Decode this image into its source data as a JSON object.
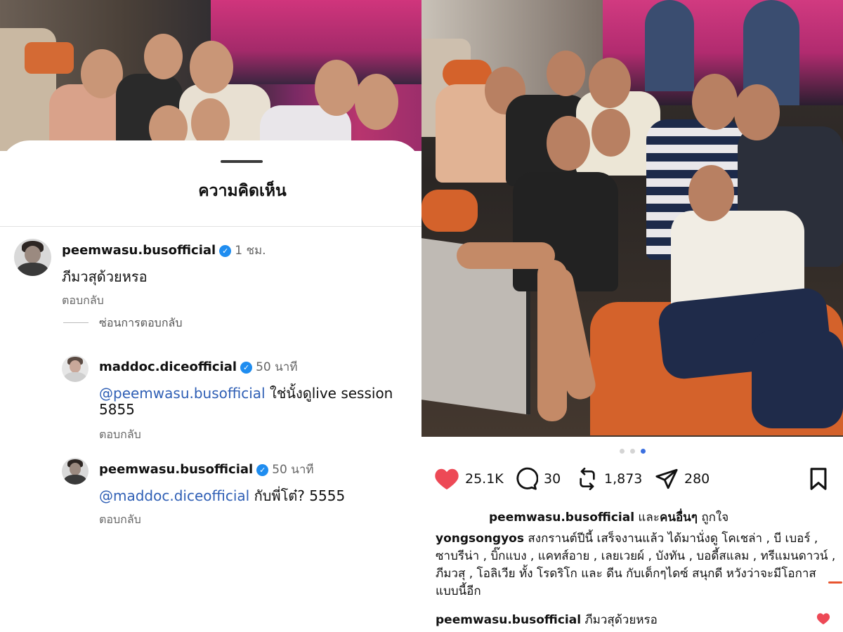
{
  "left_panel": {
    "sheet_title": "ความคิดเห็น",
    "comments": [
      {
        "username": "peemwasu.busofficial",
        "verified": true,
        "timestamp": "1 ชม.",
        "text": "ภีมวสุด้วยหรอ",
        "reply_label": "ตอบกลับ",
        "hide_replies_label": "ซ่อนการตอบกลับ"
      }
    ],
    "replies": [
      {
        "username": "maddoc.diceofficial",
        "verified": true,
        "timestamp": "50 นาที",
        "mention": "@peemwasu.busofficial",
        "text_after_mention": " ใช่นั้งดูlive session",
        "text_line2": "5855",
        "reply_label": "ตอบกลับ"
      },
      {
        "username": "peemwasu.busofficial",
        "verified": true,
        "timestamp": "50 นาที",
        "mention": "@maddoc.diceofficial",
        "text_after_mention": " กับพี่โต๋? 5555",
        "reply_label": "ตอบกลับ"
      }
    ]
  },
  "right_panel": {
    "carousel": {
      "total": 3,
      "active_index": 2
    },
    "actions": {
      "likes": "25.1K",
      "comments": "30",
      "reposts": "1,873",
      "shares": "280"
    },
    "liked_by": {
      "user": "peemwasu.busofficial",
      "connector": " และ",
      "others": "คนอื่นๆ",
      "suffix": " ถูกใจ"
    },
    "caption": {
      "username": "yongsongyos",
      "text_before": " สงกรานต์ปีนี้ เสร็จงานแล้ว ได้มานั่งดู โคเชล่า , บี เบอร์ , ซาบรีน่า , บิ๊กแบง , แคทส์อาย , เลยเวยผ์ , บังทัน , บอดี้สแลม , ทรีแมนดาวน์ ,",
      "highlight": " ภีมวสุ ,",
      "text_after": " โอลิเวีย ทั้ง โรดริโก และ ดีน กับเด็กๆไดซ์ สนุกดี หวังว่าจะมีโอกาสแบบนี้อีก"
    },
    "top_comment": {
      "username": "peemwasu.busofficial",
      "text": " ภีมวสุด้วยหรอ"
    },
    "colors": {
      "like_red": "#ed4956",
      "mention_blue": "#2f5fb5",
      "verified_blue": "#1f8df0",
      "carousel_active": "#3b6fe0",
      "underline_orange": "#e8552f"
    }
  }
}
